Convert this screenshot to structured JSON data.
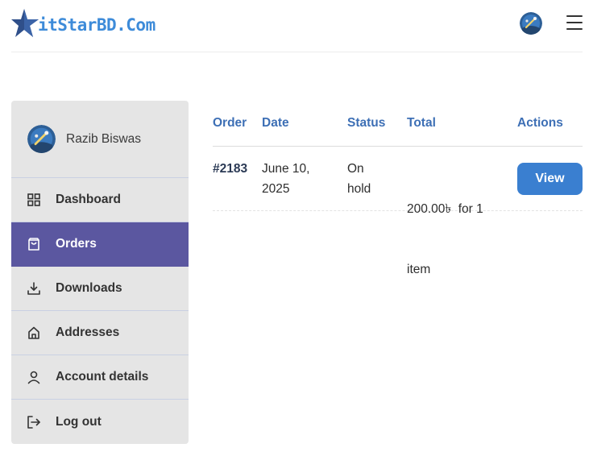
{
  "header": {
    "logo_text": "itStarBD.Com",
    "logo_icon": "star-icon",
    "avatar_icon": "user-avatar",
    "menu_icon": "hamburger-menu-icon"
  },
  "sidebar": {
    "user_name": "Razib Biswas",
    "items": [
      {
        "label": "Dashboard",
        "icon": "grid-icon",
        "active": false
      },
      {
        "label": "Orders",
        "icon": "shopping-bag-icon",
        "active": true
      },
      {
        "label": "Downloads",
        "icon": "download-icon",
        "active": false
      },
      {
        "label": "Addresses",
        "icon": "home-icon",
        "active": false
      },
      {
        "label": "Account details",
        "icon": "user-icon",
        "active": false
      },
      {
        "label": "Log out",
        "icon": "logout-icon",
        "active": false
      }
    ]
  },
  "orders": {
    "columns": [
      "Order",
      "Date",
      "Status",
      "Total",
      "Actions"
    ],
    "rows": [
      {
        "order": "#2183",
        "date_line1": "June 10,",
        "date_line2": "2025",
        "status_line1": "On",
        "status_line2": "hold",
        "total_line1": "200.00৳  for 1",
        "total_line2": "item",
        "action": "View"
      }
    ]
  },
  "colors": {
    "accent": "#3a7fd0",
    "heading": "#3d6fb5",
    "active_nav": "#5b57a0",
    "sidebar_bg": "#e5e5e5",
    "logo": "#3d8bd9"
  }
}
